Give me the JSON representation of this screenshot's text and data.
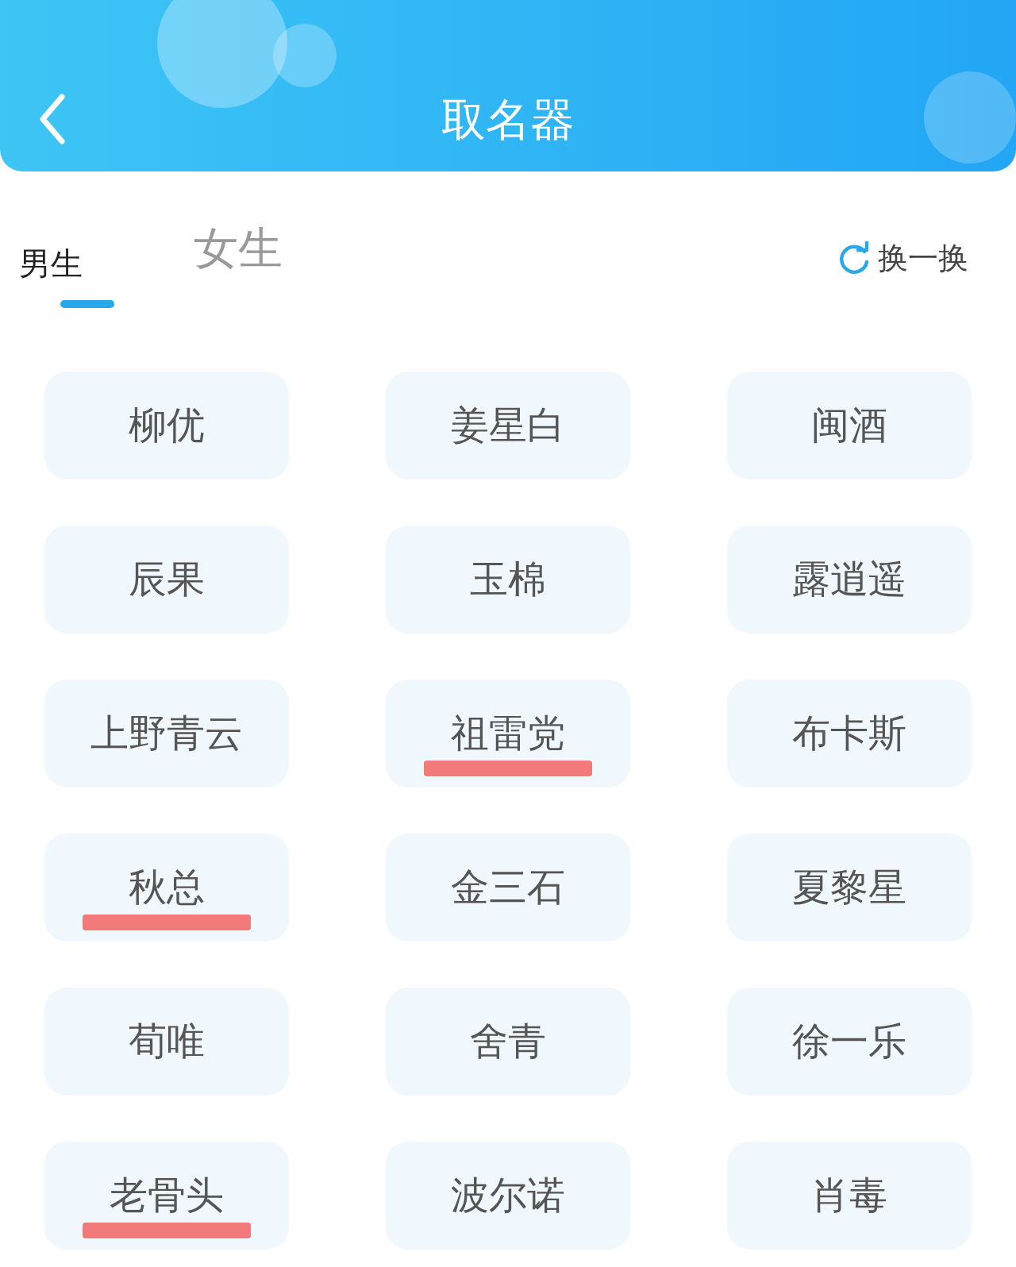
{
  "header": {
    "title": "取名器"
  },
  "tabs": [
    {
      "label": "男生",
      "selected": true
    },
    {
      "label": "女生",
      "selected": false
    }
  ],
  "refresh": {
    "label": "换一换"
  },
  "names": [
    {
      "label": "柳优",
      "underlined": false
    },
    {
      "label": "姜星白",
      "underlined": false
    },
    {
      "label": "闽酒",
      "underlined": false
    },
    {
      "label": "辰果",
      "underlined": false
    },
    {
      "label": "玉棉",
      "underlined": false
    },
    {
      "label": "露逍遥",
      "underlined": false
    },
    {
      "label": "上野青云",
      "underlined": false
    },
    {
      "label": "祖雷党",
      "underlined": true
    },
    {
      "label": "布卡斯",
      "underlined": false
    },
    {
      "label": "秋总",
      "underlined": true
    },
    {
      "label": "金三石",
      "underlined": false
    },
    {
      "label": "夏黎星",
      "underlined": false
    },
    {
      "label": "荀唯",
      "underlined": false
    },
    {
      "label": "舍青",
      "underlined": false
    },
    {
      "label": "徐一乐",
      "underlined": false
    },
    {
      "label": "老骨头",
      "underlined": true
    },
    {
      "label": "波尔诺",
      "underlined": false
    },
    {
      "label": "肖毒",
      "underlined": false
    }
  ]
}
